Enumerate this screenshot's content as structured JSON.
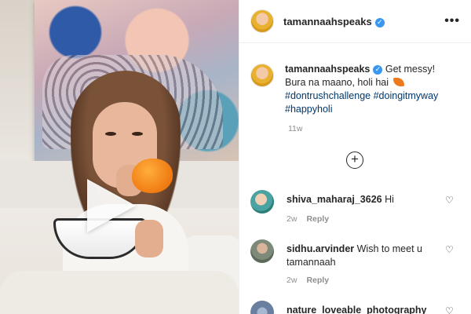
{
  "post": {
    "username": "tamannaahspeaks",
    "verified_mark": "✓",
    "more_glyph": "•••",
    "caption_part1": " Get messy!",
    "caption_part2": "Bura na maano, holi hai ",
    "hashtags": [
      "#dontrushchallenge",
      "#doingitmyway",
      "#happyholi"
    ],
    "time_ago": "11w",
    "load_more_glyph": "+"
  },
  "comments": [
    {
      "username": "shiva_maharaj_3626",
      "text": " Hi",
      "time": "2w",
      "reply": "Reply"
    },
    {
      "username": "sidhu.arvinder",
      "text": " Wish to meet u tamannaah",
      "time": "2w",
      "reply": "Reply"
    },
    {
      "username": "nature_loveable_photography",
      "text": "",
      "time": "",
      "reply": ""
    }
  ],
  "icons": {
    "heart": "♡",
    "leaf": "leaf-emoji-icon",
    "play": "play-icon",
    "avatar_colors": [
      "#e8b230",
      "#4aa3a0",
      "#7d8a7a",
      "#6a7fa0"
    ]
  }
}
